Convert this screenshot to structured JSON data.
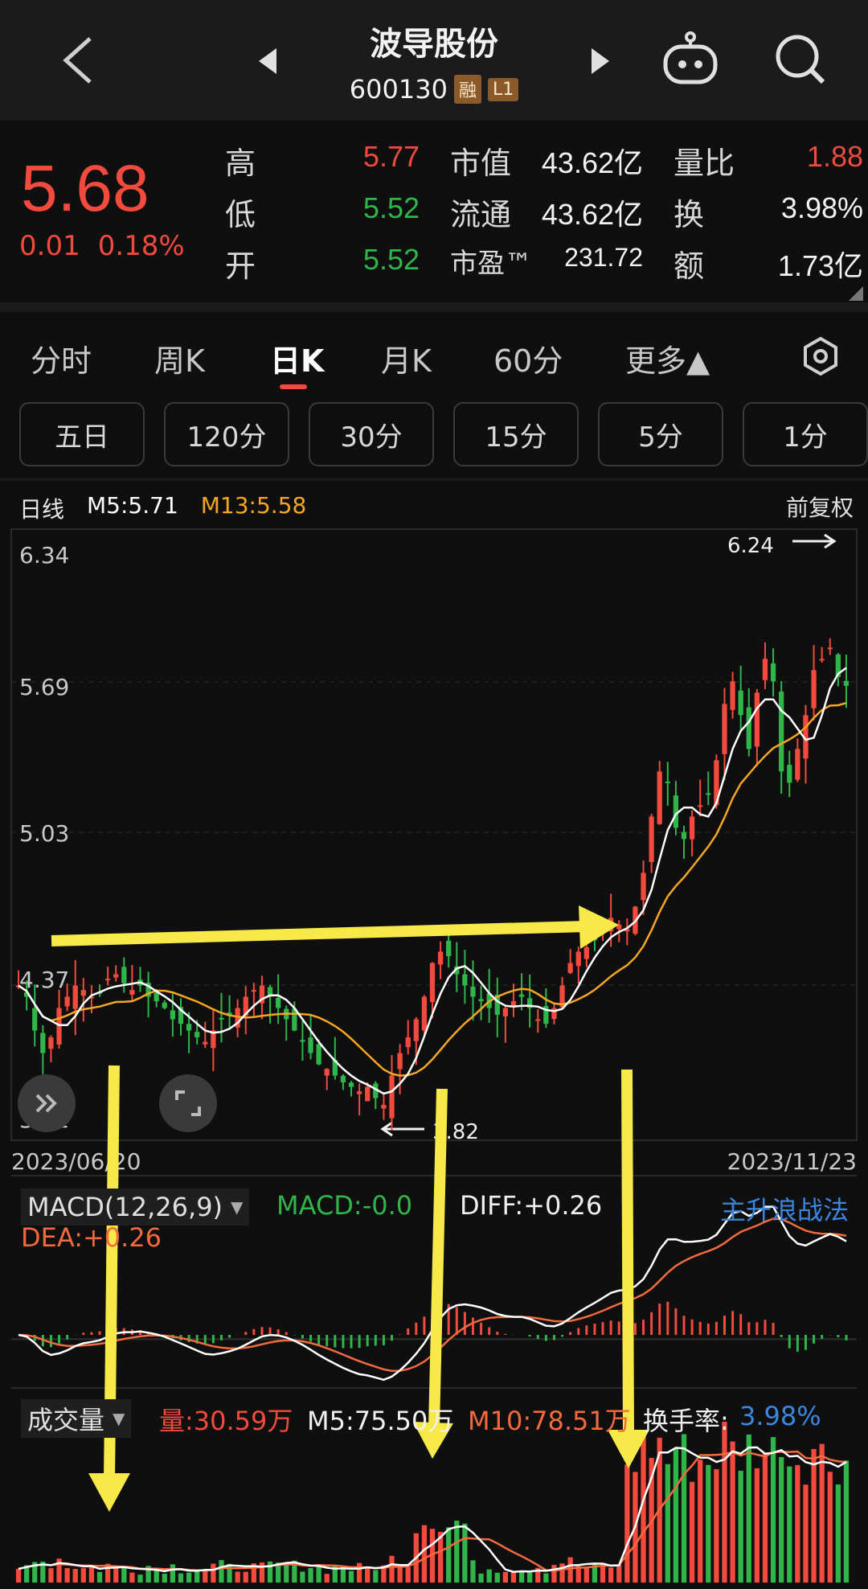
{
  "header": {
    "stock_name": "波导股份",
    "code": "600130",
    "badges": [
      "融",
      "L1"
    ]
  },
  "quote": {
    "price": "5.68",
    "change": "0.01",
    "change_pct": "0.18%",
    "high_label": "高",
    "high": "5.77",
    "low_label": "低",
    "low": "5.52",
    "open_label": "开",
    "open": "5.52",
    "mktcap_label": "市值",
    "mktcap": "43.62亿",
    "float_label": "流通",
    "float": "43.62亿",
    "pe_label": "市盈™",
    "pe": "231.72",
    "vol_ratio_label": "量比",
    "vol_ratio": "1.88",
    "turnover_label": "换",
    "turnover": "3.98%",
    "amount_label": "额",
    "amount": "1.73亿"
  },
  "tabs": [
    "分时",
    "周K",
    "日K",
    "月K",
    "60分",
    "更多▲"
  ],
  "active_tab": "日K",
  "chips": [
    "五日",
    "120分",
    "30分",
    "15分",
    "5分",
    "1分"
  ],
  "kline": {
    "line_label": "日线",
    "ma5": "M5:5.71",
    "ma13": "M13:5.58",
    "restore": "前复权",
    "y_ticks": [
      "6.34",
      "5.69",
      "5.03",
      "4.37",
      "3.72"
    ],
    "high_mark": "6.24",
    "low_mark": "3.82",
    "date_start": "2023/06/20",
    "date_end": "2023/11/23"
  },
  "macd": {
    "selector": "MACD(12,26,9)",
    "macd": "MACD:-0.0",
    "diff": "DIFF:+0.26",
    "dea": "DEA:+0.26",
    "strategy": "主升浪战法"
  },
  "volume": {
    "selector": "成交量",
    "vol": "量:30.59万",
    "m5": "M5:75.50万",
    "m10": "M10:78.51万",
    "turnover_label": "换手率:",
    "turnover": "3.98%"
  },
  "chart_data": {
    "type": "candlestick",
    "ylim": [
      3.72,
      6.34
    ],
    "close_series_approx": [
      4.35,
      4.3,
      4.15,
      4.05,
      4.12,
      4.25,
      4.3,
      4.35,
      4.33,
      4.3,
      4.32,
      4.38,
      4.4,
      4.36,
      4.33,
      4.35,
      4.3,
      4.28,
      4.25,
      4.2,
      4.18,
      4.15,
      4.12,
      4.1,
      4.15,
      4.2,
      4.22,
      4.25,
      4.3,
      4.33,
      4.35,
      4.3,
      4.25,
      4.2,
      4.15,
      4.1,
      4.05,
      4.0,
      3.98,
      3.95,
      3.92,
      3.9,
      3.88,
      3.9,
      3.85,
      3.82,
      3.95,
      4.05,
      4.12,
      4.2,
      4.3,
      4.45,
      4.5,
      4.48,
      4.4,
      4.35,
      4.3,
      4.28,
      4.25,
      4.22,
      4.25,
      4.28,
      4.3,
      4.25,
      4.2,
      4.18,
      4.25,
      4.35,
      4.45,
      4.5,
      4.52,
      4.55,
      4.6,
      4.65,
      4.62,
      4.6,
      4.7,
      4.85,
      5.1,
      5.3,
      5.25,
      5.05,
      5.0,
      5.1,
      5.15,
      5.2,
      5.35,
      5.6,
      5.7,
      5.55,
      5.4,
      5.65,
      5.8,
      5.7,
      5.3,
      5.25,
      5.4,
      5.55,
      5.75,
      5.8,
      5.85,
      5.72,
      5.68
    ]
  },
  "colors": {
    "up": "#f24a3d",
    "down": "#2fb54a",
    "ma5": "#ffffff",
    "ma13": "#f5a623",
    "arrow": "#f7e948",
    "link": "#3b86e0"
  }
}
